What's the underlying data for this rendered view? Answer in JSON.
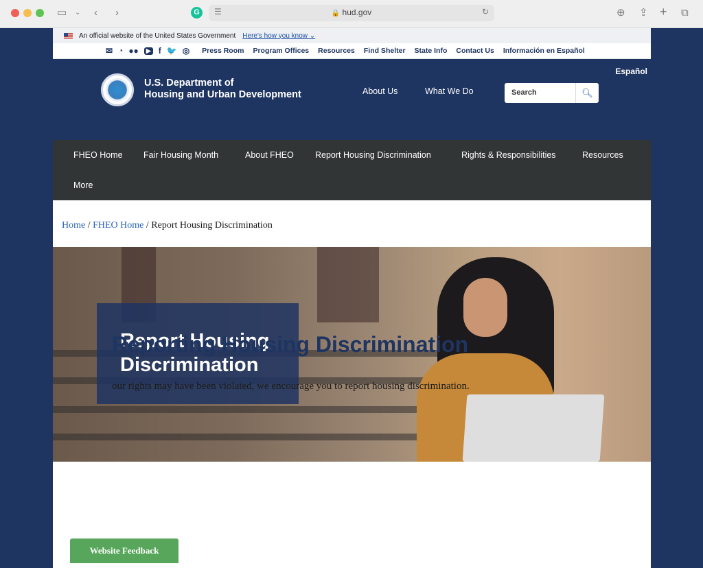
{
  "browser": {
    "url": "hud.gov",
    "icons": [
      "sidebar-icon",
      "chevron-down-icon",
      "back-icon",
      "forward-icon",
      "grammarly-icon",
      "reader-icon",
      "lock-icon",
      "reload-icon",
      "download-icon",
      "share-icon",
      "new-tab-icon",
      "tabs-overview-icon"
    ]
  },
  "gov_banner": {
    "text": "An official website of the United States Government",
    "link": "Here's how you know"
  },
  "utility": {
    "social": [
      "email-icon",
      "rss-icon",
      "flickr-icon",
      "youtube-icon",
      "facebook-icon",
      "twitter-icon",
      "instagram-icon"
    ],
    "links": [
      "Press Room",
      "Program Offices",
      "Resources",
      "Find Shelter",
      "State Info",
      "Contact Us",
      "Información en Español"
    ]
  },
  "header": {
    "brand_line1": "U.S. Department of",
    "brand_line2": "Housing and Urban Development",
    "nav": [
      "About Us",
      "What We Do"
    ],
    "search_placeholder": "Search",
    "espanol": "Español"
  },
  "subnav": {
    "items": [
      "FHEO Home",
      "Fair Housing Month",
      "About FHEO",
      "Report Housing Discrimination",
      "Rights & Responsibilities",
      "Resources",
      "More"
    ]
  },
  "breadcrumb": {
    "home": "Home",
    "fheo": "FHEO Home",
    "current": "Report Housing Discrimination",
    "sep": "/"
  },
  "hero": {
    "title": "Report Housing Discrimination"
  },
  "main": {
    "heading": "Reporting Housing Discrimination",
    "intro_visible": "our rights may have been violated, we encourage you to report housing discrimination."
  },
  "feedback": {
    "label": "Website Feedback"
  },
  "colors": {
    "brand_navy": "#1e3461",
    "subnav_bg": "#323535",
    "link_blue": "#2a63b5",
    "feedback_green": "#58a65b"
  }
}
